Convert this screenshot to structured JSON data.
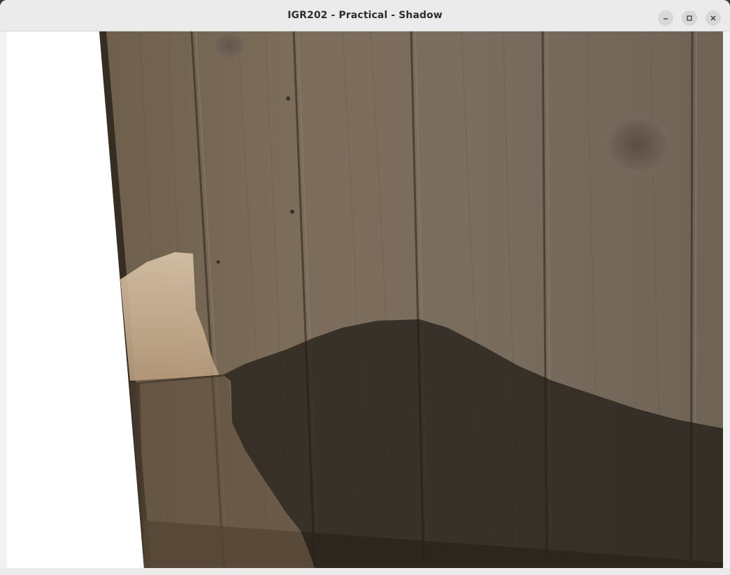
{
  "window": {
    "title": "IGR202 - Practical - Shadow",
    "controls": [
      {
        "name": "minimize",
        "icon": "minimize-icon"
      },
      {
        "name": "maximize",
        "icon": "maximize-icon"
      },
      {
        "name": "close",
        "icon": "close-icon"
      }
    ]
  },
  "scene": {
    "background_color": "#ffffff",
    "wood_color": "#7a6a58",
    "shadow_color": "#2a261f",
    "lit_patch_color": "#c8b49a"
  }
}
